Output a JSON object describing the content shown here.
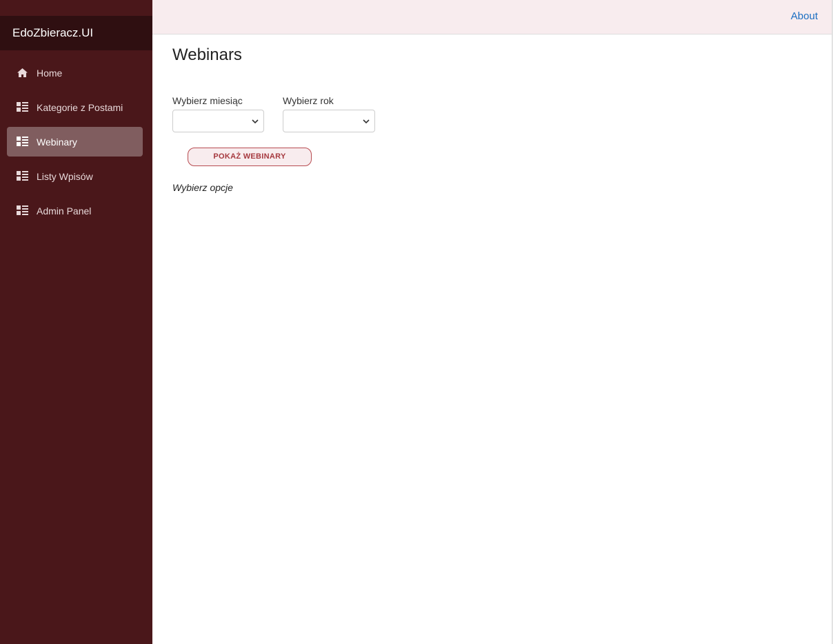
{
  "app": {
    "brand": "EdoZbieracz.UI"
  },
  "topbar": {
    "about_label": "About"
  },
  "sidebar": {
    "items": [
      {
        "label": "Home",
        "icon": "home-icon",
        "active": false
      },
      {
        "label": "Kategorie z Postami",
        "icon": "list-icon",
        "active": false
      },
      {
        "label": "Webinary",
        "icon": "list-icon",
        "active": true
      },
      {
        "label": "Listy Wpisów",
        "icon": "list-icon",
        "active": false
      },
      {
        "label": "Admin Panel",
        "icon": "list-icon",
        "active": false
      }
    ]
  },
  "main": {
    "title": "Webinars",
    "month_label": "Wybierz miesiąc",
    "month_value": "",
    "year_label": "Wybierz rok",
    "year_value": "",
    "show_button_label": "POKAŻ WEBINARY",
    "hint": "Wybierz opcje"
  },
  "colors": {
    "sidebar_bg": "#4a171a",
    "brand_bar_bg": "#2f0f11",
    "topbar_bg": "#f8ecee",
    "link": "#1b6ec2",
    "button_border": "#b74a4f",
    "button_text": "#a6393f"
  }
}
